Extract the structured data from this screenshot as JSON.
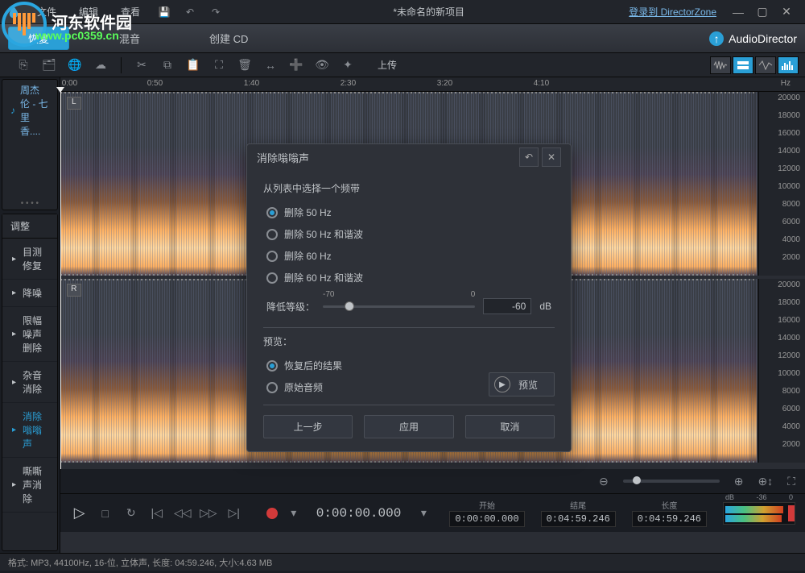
{
  "titlebar": {
    "menu": {
      "file": "文件",
      "edit": "编辑",
      "view": "查看"
    },
    "project_title": "未命名的新项目",
    "dz_link": "登录到 DirectorZone"
  },
  "tabs": {
    "restore": "恢复",
    "mix": "混音",
    "create_cd": "创建 CD",
    "brand": "AudioDirector"
  },
  "toolbar": {
    "upload": "上传"
  },
  "watermark": {
    "line1": "河东软件园",
    "line2": "www.pc0359.cn"
  },
  "file_item": "周杰伦 - 七里香....",
  "adjust": {
    "title": "调整",
    "items": [
      "目测修复",
      "降噪",
      "限幅噪声删除",
      "杂音消除",
      "消除嗡嗡声",
      "嘶嘶声消除"
    ],
    "active_index": 4
  },
  "ruler_ticks": [
    "0:00",
    "0:50",
    "1:40",
    "2:30",
    "3:20",
    "4:10"
  ],
  "channels": [
    "L",
    "R"
  ],
  "freq_unit": "Hz",
  "freq_ticks": [
    "20000",
    "18000",
    "16000",
    "14000",
    "12000",
    "10000",
    "8000",
    "6000",
    "4000",
    "2000"
  ],
  "dialog": {
    "title": "消除嗡嗡声",
    "band_label": "从列表中选择一个频带",
    "options": [
      "删除 50 Hz",
      "删除 50 Hz 和谐波",
      "删除 60 Hz",
      "删除 60 Hz 和谐波"
    ],
    "selected_option": 0,
    "level_label": "降低等级：",
    "level_min": "-70",
    "level_max": "0",
    "level_value": "-60",
    "level_unit": "dB",
    "preview_label": "预览：",
    "preview_options": [
      "恢复后的结果",
      "原始音频"
    ],
    "preview_selected": 0,
    "preview_btn": "预览",
    "buttons": {
      "back": "上一步",
      "apply": "应用",
      "cancel": "取消"
    }
  },
  "transport": {
    "timecode": "0:00:00.000",
    "start_label": "开始",
    "start_val": "0:00:00.000",
    "end_label": "结尾",
    "end_val": "0:04:59.246",
    "len_label": "长度",
    "len_val": "0:04:59.246",
    "meter_scale": [
      "dB",
      "-36",
      "0"
    ]
  },
  "statusbar": "格式: MP3, 44100Hz, 16-位, 立体声, 长度: 04:59.246, 大小:4.63 MB"
}
